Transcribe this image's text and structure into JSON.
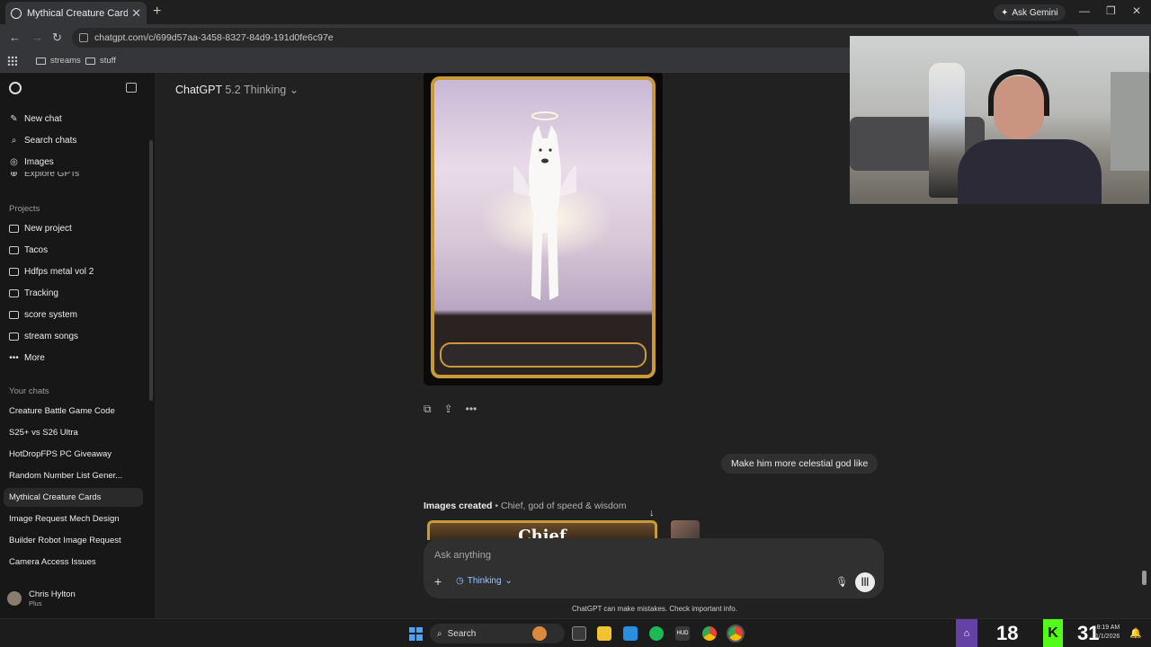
{
  "browser": {
    "tab_title": "Mythical Creature Cards",
    "tab_close": "✕",
    "new_tab": "+",
    "ask_gemini": "Ask Gemini",
    "url": "chatgpt.com/c/699d57aa-3458-8327-84d9-191d0fe6c97e",
    "bookmarks": [
      "streams",
      "stuff"
    ]
  },
  "sidebar": {
    "new_chat": "New chat",
    "search_chats": "Search chats",
    "images": "Images",
    "explore_gpts": "Explore GPTs",
    "projects_header": "Projects",
    "projects": [
      "New project",
      "Tacos",
      "Hdfps metal vol 2",
      "Tracking",
      "score system",
      "stream songs",
      "More"
    ],
    "chats_header": "Your chats",
    "chats": [
      "Creature Battle Game Code",
      "S25+ vs S26 Ultra",
      "HotDropFPS PC Giveaway",
      "Random Number List Gener...",
      "Mythical Creature Cards",
      "Image Request Mech Design",
      "Builder Robot Image Request",
      "Camera Access Issues"
    ],
    "active_chat_index": 4,
    "user_name": "Chris Hylton",
    "user_plan": "Plus"
  },
  "main": {
    "model_name": "ChatGPT",
    "model_version": "5.2 Thinking",
    "user_message": "Make him more celestial god like",
    "images_created": "Images created",
    "images_created_sub": "• Chief, god of speed & wisdom",
    "card_title_partial": "Chief",
    "composer_placeholder": "Ask anything",
    "thinking_label": "Thinking",
    "disclaimer": "ChatGPT can make mistakes. Check important info."
  },
  "taskbar": {
    "search": "Search",
    "viewer_count_twitch": "18",
    "viewer_count_kick": "31",
    "time": "8:19 AM",
    "date": "1/1/2026"
  },
  "colors": {
    "accent_gold": "#c99a3a",
    "twitch": "#6441a5",
    "kick": "#53fc18"
  }
}
